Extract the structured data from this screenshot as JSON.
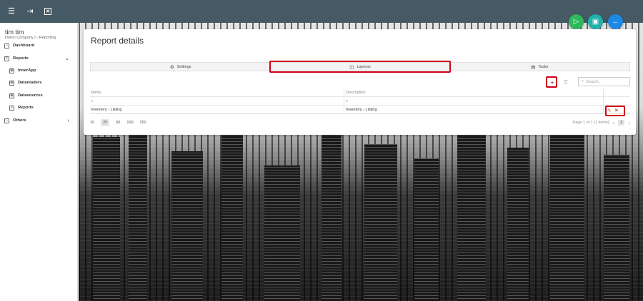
{
  "topbar": {
    "icons": [
      "menu-icon",
      "logout-icon",
      "close-box-icon"
    ],
    "glyphs": [
      "☰",
      "⇥",
      "✕"
    ]
  },
  "sidebar": {
    "user_name": "tim tim",
    "company": "Demo Company I - Reporting",
    "items": [
      {
        "label": "Dashboard",
        "icon": "dashboard-icon"
      },
      {
        "label": "Reports",
        "icon": "document-icon"
      },
      {
        "label": "InnerApp",
        "icon": "table-icon"
      },
      {
        "label": "Datareaders",
        "icon": "table-icon"
      },
      {
        "label": "Datasources",
        "icon": "table-icon"
      },
      {
        "label": "Reports",
        "icon": "document-icon"
      },
      {
        "label": "Others",
        "icon": "bank-icon"
      }
    ]
  },
  "fabs": [
    {
      "name": "run-button",
      "icon": "play-icon",
      "color": "#2eb85c",
      "glyph": "▷"
    },
    {
      "name": "save-button",
      "icon": "save-icon",
      "color": "#20b2aa",
      "glyph": "▣"
    },
    {
      "name": "back-button",
      "icon": "arrow-left-icon",
      "color": "#1e88e5",
      "glyph": "←"
    }
  ],
  "panel": {
    "title": "Report details",
    "tabs": [
      {
        "label": "Settings",
        "icon": "gear-icon",
        "glyph": "⚙"
      },
      {
        "label": "Layouts",
        "icon": "layout-icon",
        "glyph": "◫"
      },
      {
        "label": "Tasks",
        "icon": "calendar-icon",
        "glyph": "▤"
      }
    ],
    "toolbar": {
      "add_glyph": "+",
      "export_glyph": "⎕",
      "search_placeholder": "Search..."
    },
    "grid": {
      "columns": [
        "Name",
        "Description"
      ],
      "filter_glyph": "⌕",
      "rows": [
        {
          "name": "Inventory - Listing",
          "description": "Inventory - Listing"
        }
      ]
    },
    "pager": {
      "sizes": [
        "10",
        "25",
        "50",
        "100",
        "250"
      ],
      "selected_size": "25",
      "info": "Page 1 of 1 (1 items)",
      "current_page": "1"
    }
  },
  "colors": {
    "topbar": "#455a64",
    "highlight": "#d0021b"
  }
}
